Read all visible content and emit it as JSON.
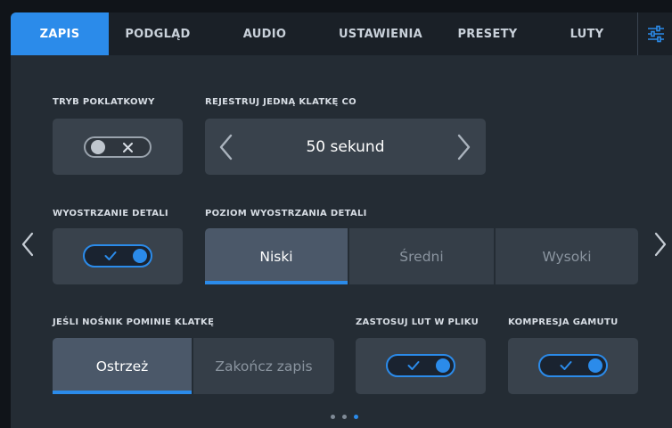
{
  "tabs": [
    {
      "label": "ZAPIS",
      "active": true
    },
    {
      "label": "PODGLĄD",
      "active": false
    },
    {
      "label": "AUDIO",
      "active": false
    },
    {
      "label": "USTAWIENIA",
      "active": false
    },
    {
      "label": "PRESETY",
      "active": false
    },
    {
      "label": "LUTY",
      "active": false
    }
  ],
  "settings_icon": "sliders-icon",
  "timelapse": {
    "label": "TRYB POKLATKOWY",
    "enabled": false
  },
  "frame_interval": {
    "label": "REJESTRUJ JEDNĄ KLATKĘ CO",
    "value": "50 sekund"
  },
  "detail_sharpening": {
    "label": "WYOSTRZANIE DETALI",
    "enabled": true
  },
  "sharpening_level": {
    "label": "POZIOM WYOSTRZANIA DETALI",
    "options": [
      "Niski",
      "Średni",
      "Wysoki"
    ],
    "selected": "Niski"
  },
  "dropped_frame": {
    "label": "JEŚLI NOŚNIK POMINIE KLATKĘ",
    "options": [
      "Ostrzeż",
      "Zakończ zapis"
    ],
    "selected": "Ostrzeż"
  },
  "apply_lut": {
    "label": "ZASTOSUJ LUT W PLIKU",
    "enabled": true
  },
  "gamut_compression": {
    "label": "KOMPRESJA GAMUTU",
    "enabled": true
  },
  "pagination": {
    "pages": 3,
    "current": 3
  },
  "colors": {
    "accent": "#2b8bea",
    "panel": "#39424c",
    "background": "#242c34"
  }
}
